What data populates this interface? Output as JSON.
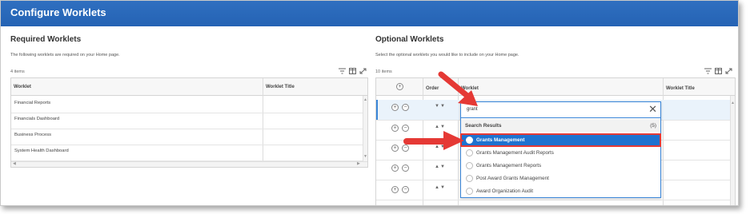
{
  "header": {
    "title": "Configure Worklets"
  },
  "required": {
    "title": "Required Worklets",
    "description": "The following worklets are required on your Home page.",
    "count": "4 items",
    "columns": [
      "Worklet",
      "Worklet Title"
    ],
    "rows": [
      "Financial Reports",
      "Financials Dashboard",
      "Business Process",
      "System Health Dashboard"
    ]
  },
  "optional": {
    "title": "Optional Worklets",
    "description": "Select the optional worklets you would like to include on your Home page.",
    "count": "10 items",
    "columns": [
      "Order",
      "Worklet",
      "Worklet Title"
    ]
  },
  "dropdown": {
    "search_value": "grant",
    "results_label": "Search Results",
    "results_count": "(5)",
    "options": [
      "Grants Management",
      "Grants Management Audit Reports",
      "Grants Management Reports",
      "Post Award Grants Management",
      "Award Organization Audit"
    ],
    "selected_index": 0
  },
  "icons": {
    "filter": "filter-icon",
    "columns": "columns-icon",
    "expand": "expand-icon",
    "add": "add-circle-icon",
    "remove": "remove-circle-icon",
    "move": "move-up-down-icon",
    "close": "close-icon"
  },
  "colors": {
    "header_blue": "#2563b4",
    "selection_blue": "#1e72d0",
    "annotation_red": "#e53935"
  }
}
